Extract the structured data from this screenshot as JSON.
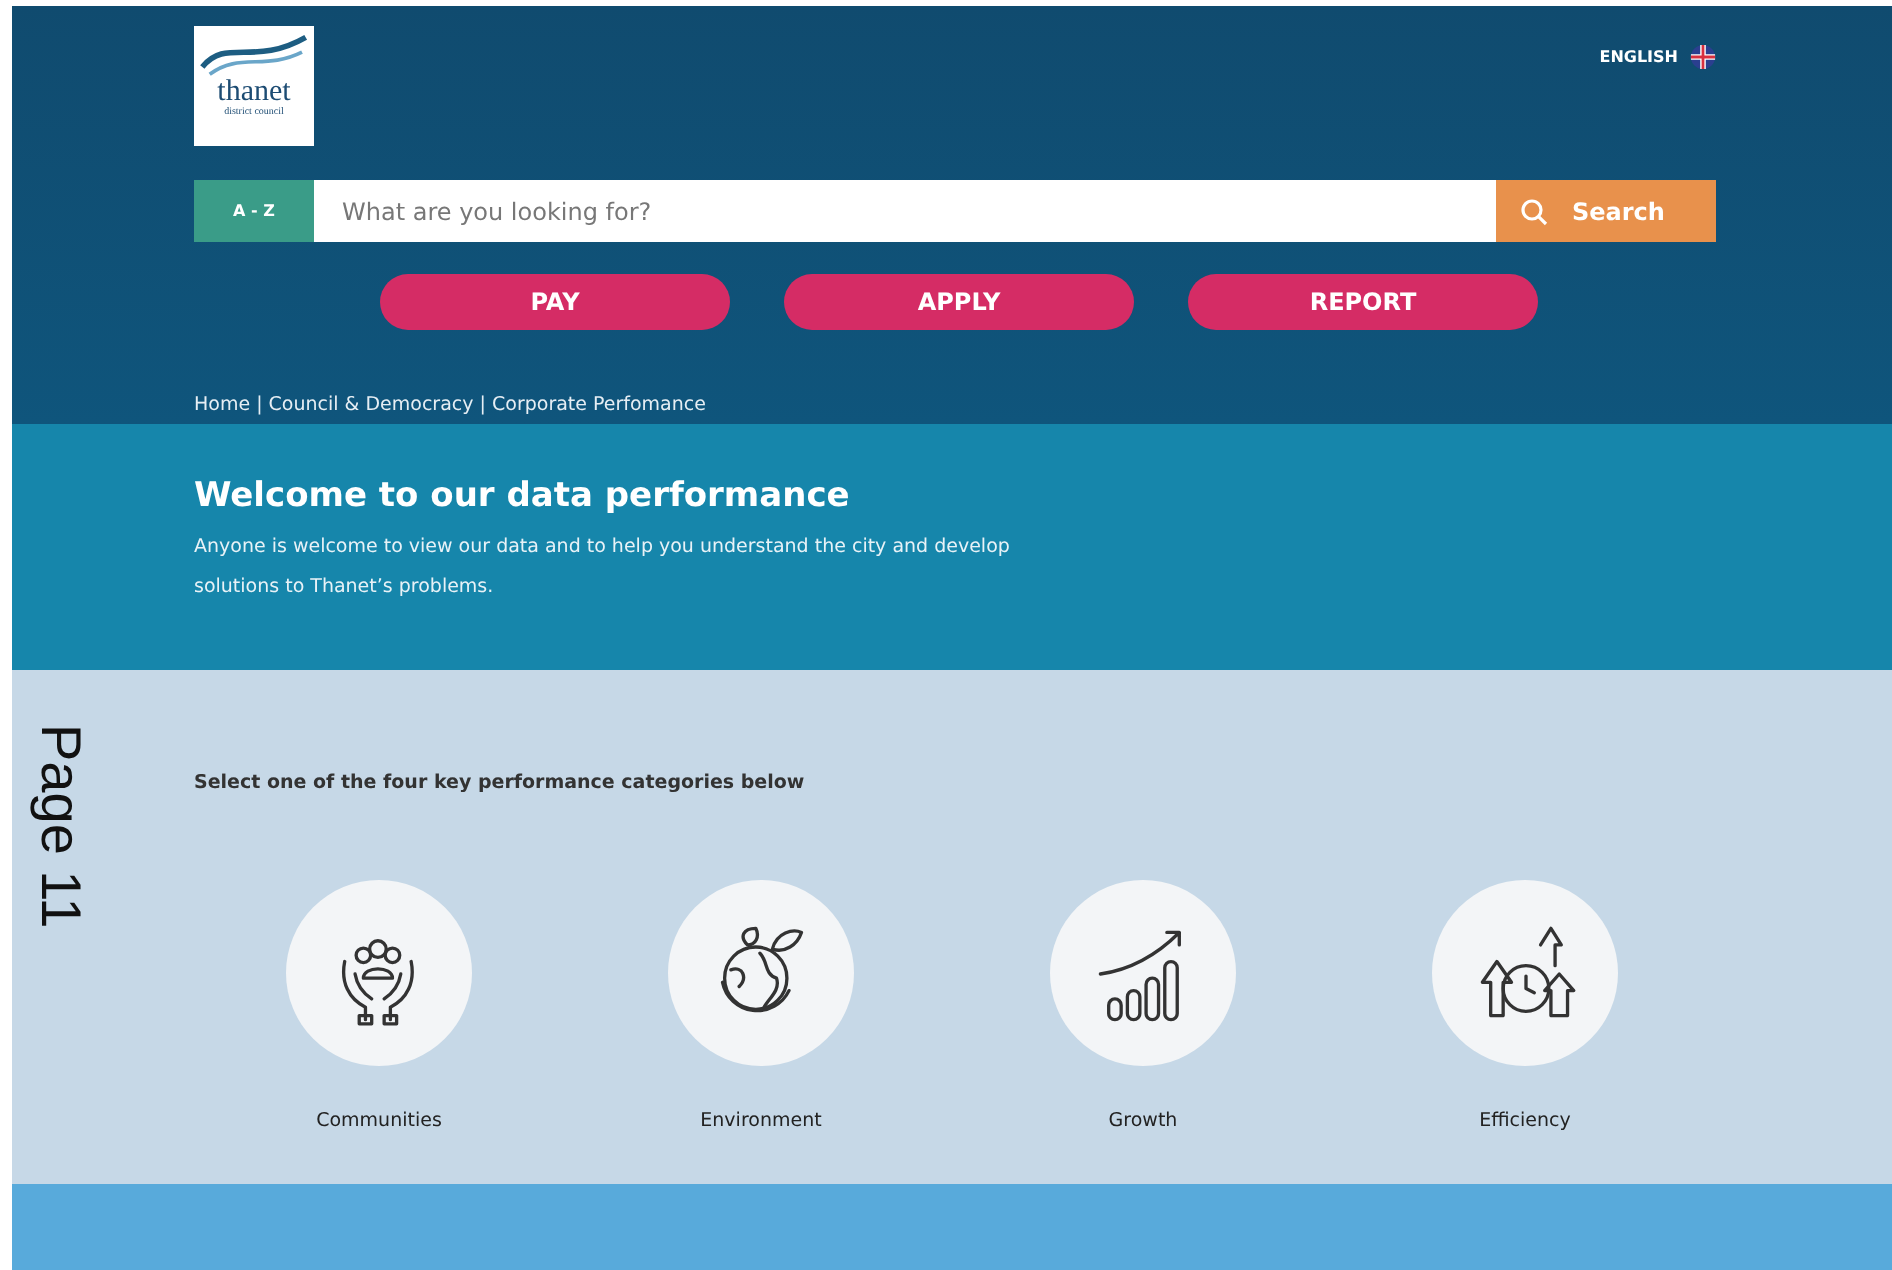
{
  "page_label": "Page 11",
  "header": {
    "logo": {
      "name": "thanet",
      "subtitle": "district council"
    },
    "language": "ENGLISH",
    "search": {
      "az": "A - Z",
      "placeholder": "What are you looking for?",
      "button": "Search"
    },
    "actions": [
      "PAY",
      "APPLY",
      "REPORT"
    ],
    "breadcrumb": "Home | Council & Democracy | Corporate Perfomance"
  },
  "welcome": {
    "title": "Welcome to our data performance",
    "text": "Anyone is welcome to view our data and to help you understand the city and develop solutions to Thanet’s problems."
  },
  "categories": {
    "intro": "Select one of the four key performance categories below",
    "items": [
      {
        "label": "Communities",
        "kind": "hands"
      },
      {
        "label": "Environment",
        "kind": "globe"
      },
      {
        "label": "Growth",
        "kind": "growth"
      },
      {
        "label": "Efficiency",
        "kind": "clock"
      }
    ]
  }
}
